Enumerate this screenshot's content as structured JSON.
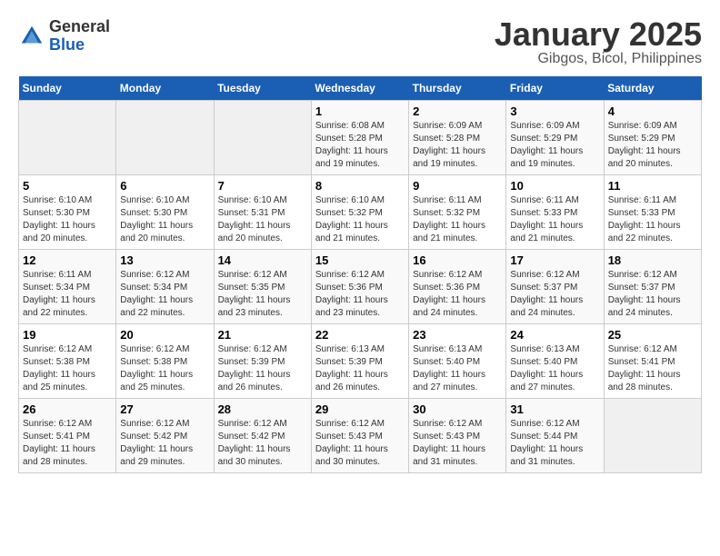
{
  "logo": {
    "general": "General",
    "blue": "Blue"
  },
  "title": "January 2025",
  "subtitle": "Gibgos, Bicol, Philippines",
  "days_of_week": [
    "Sunday",
    "Monday",
    "Tuesday",
    "Wednesday",
    "Thursday",
    "Friday",
    "Saturday"
  ],
  "weeks": [
    [
      {
        "day": "",
        "info": ""
      },
      {
        "day": "",
        "info": ""
      },
      {
        "day": "",
        "info": ""
      },
      {
        "day": "1",
        "sunrise": "6:08 AM",
        "sunset": "5:28 PM",
        "daylight": "11 hours and 19 minutes."
      },
      {
        "day": "2",
        "sunrise": "6:09 AM",
        "sunset": "5:28 PM",
        "daylight": "11 hours and 19 minutes."
      },
      {
        "day": "3",
        "sunrise": "6:09 AM",
        "sunset": "5:29 PM",
        "daylight": "11 hours and 19 minutes."
      },
      {
        "day": "4",
        "sunrise": "6:09 AM",
        "sunset": "5:29 PM",
        "daylight": "11 hours and 20 minutes."
      }
    ],
    [
      {
        "day": "5",
        "sunrise": "6:10 AM",
        "sunset": "5:30 PM",
        "daylight": "11 hours and 20 minutes."
      },
      {
        "day": "6",
        "sunrise": "6:10 AM",
        "sunset": "5:30 PM",
        "daylight": "11 hours and 20 minutes."
      },
      {
        "day": "7",
        "sunrise": "6:10 AM",
        "sunset": "5:31 PM",
        "daylight": "11 hours and 20 minutes."
      },
      {
        "day": "8",
        "sunrise": "6:10 AM",
        "sunset": "5:32 PM",
        "daylight": "11 hours and 21 minutes."
      },
      {
        "day": "9",
        "sunrise": "6:11 AM",
        "sunset": "5:32 PM",
        "daylight": "11 hours and 21 minutes."
      },
      {
        "day": "10",
        "sunrise": "6:11 AM",
        "sunset": "5:33 PM",
        "daylight": "11 hours and 21 minutes."
      },
      {
        "day": "11",
        "sunrise": "6:11 AM",
        "sunset": "5:33 PM",
        "daylight": "11 hours and 22 minutes."
      }
    ],
    [
      {
        "day": "12",
        "sunrise": "6:11 AM",
        "sunset": "5:34 PM",
        "daylight": "11 hours and 22 minutes."
      },
      {
        "day": "13",
        "sunrise": "6:12 AM",
        "sunset": "5:34 PM",
        "daylight": "11 hours and 22 minutes."
      },
      {
        "day": "14",
        "sunrise": "6:12 AM",
        "sunset": "5:35 PM",
        "daylight": "11 hours and 23 minutes."
      },
      {
        "day": "15",
        "sunrise": "6:12 AM",
        "sunset": "5:36 PM",
        "daylight": "11 hours and 23 minutes."
      },
      {
        "day": "16",
        "sunrise": "6:12 AM",
        "sunset": "5:36 PM",
        "daylight": "11 hours and 24 minutes."
      },
      {
        "day": "17",
        "sunrise": "6:12 AM",
        "sunset": "5:37 PM",
        "daylight": "11 hours and 24 minutes."
      },
      {
        "day": "18",
        "sunrise": "6:12 AM",
        "sunset": "5:37 PM",
        "daylight": "11 hours and 24 minutes."
      }
    ],
    [
      {
        "day": "19",
        "sunrise": "6:12 AM",
        "sunset": "5:38 PM",
        "daylight": "11 hours and 25 minutes."
      },
      {
        "day": "20",
        "sunrise": "6:12 AM",
        "sunset": "5:38 PM",
        "daylight": "11 hours and 25 minutes."
      },
      {
        "day": "21",
        "sunrise": "6:12 AM",
        "sunset": "5:39 PM",
        "daylight": "11 hours and 26 minutes."
      },
      {
        "day": "22",
        "sunrise": "6:13 AM",
        "sunset": "5:39 PM",
        "daylight": "11 hours and 26 minutes."
      },
      {
        "day": "23",
        "sunrise": "6:13 AM",
        "sunset": "5:40 PM",
        "daylight": "11 hours and 27 minutes."
      },
      {
        "day": "24",
        "sunrise": "6:13 AM",
        "sunset": "5:40 PM",
        "daylight": "11 hours and 27 minutes."
      },
      {
        "day": "25",
        "sunrise": "6:12 AM",
        "sunset": "5:41 PM",
        "daylight": "11 hours and 28 minutes."
      }
    ],
    [
      {
        "day": "26",
        "sunrise": "6:12 AM",
        "sunset": "5:41 PM",
        "daylight": "11 hours and 28 minutes."
      },
      {
        "day": "27",
        "sunrise": "6:12 AM",
        "sunset": "5:42 PM",
        "daylight": "11 hours and 29 minutes."
      },
      {
        "day": "28",
        "sunrise": "6:12 AM",
        "sunset": "5:42 PM",
        "daylight": "11 hours and 30 minutes."
      },
      {
        "day": "29",
        "sunrise": "6:12 AM",
        "sunset": "5:43 PM",
        "daylight": "11 hours and 30 minutes."
      },
      {
        "day": "30",
        "sunrise": "6:12 AM",
        "sunset": "5:43 PM",
        "daylight": "11 hours and 31 minutes."
      },
      {
        "day": "31",
        "sunrise": "6:12 AM",
        "sunset": "5:44 PM",
        "daylight": "11 hours and 31 minutes."
      },
      {
        "day": "",
        "info": ""
      }
    ]
  ]
}
